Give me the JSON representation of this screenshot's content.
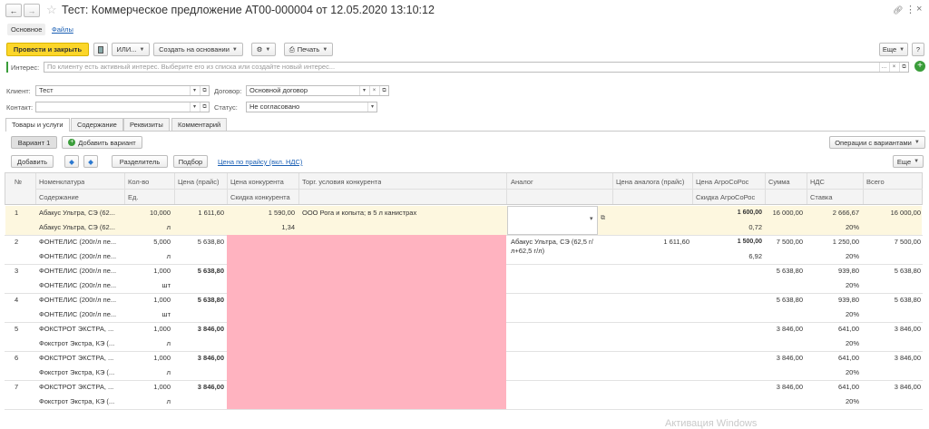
{
  "window": {
    "title": "Тест: Коммерческое предложение АТ00-000004 от 12.05.2020 13:10:12",
    "tabs": [
      "Основное",
      "Файлы"
    ]
  },
  "toolbar": {
    "post_close": "Провести и закрыть",
    "ili": "ИЛИ...",
    "create_based": "Создать на основании",
    "print": "Печать",
    "more": "Еще",
    "help": "?"
  },
  "interest": {
    "label": "Интерес:",
    "placeholder": "По клиенту есть активный интерес. Выберите его из списка или создайте новый интерес..."
  },
  "form": {
    "client_label": "Клиент:",
    "client_value": "Тест",
    "contract_label": "Договор:",
    "contract_value": "Основной договор",
    "contact_label": "Контакт:",
    "contact_value": "",
    "status_label": "Статус:",
    "status_value": "Не согласовано"
  },
  "content_tabs": [
    "Товары и услуги",
    "Содержание",
    "Реквизиты",
    "Комментарий"
  ],
  "variants": {
    "variant1": "Вариант 1",
    "add_variant": "Добавить вариант",
    "ops": "Операции с вариантами"
  },
  "table_toolbar": {
    "add": "Добавить",
    "splitter": "Разделитель",
    "selection": "Подбор",
    "price_link": "Цена по прайсу (вкл. НДС)",
    "more": "Еще"
  },
  "columns": {
    "num": "№",
    "nomenclature": "Номенклатура",
    "content": "Содержание",
    "qty": "Кол-во",
    "unit": "Ед.",
    "price": "Цена (прайс)",
    "comp_price": "Цена конкурента",
    "comp_discount": "Скидка конкурента",
    "comp_terms": "Торг. условия конкурента",
    "analog": "Аналог",
    "analog_price": "Цена аналога (прайс)",
    "agro_price": "Цена АгроСоРос",
    "agro_discount": "Скидка АгроСоРос",
    "sum": "Сумма",
    "vat": "НДС",
    "rate": "Ставка",
    "total": "Всего"
  },
  "rows": [
    {
      "n": "1",
      "nom": "Абакус Ультра, СЭ (62...",
      "cont": "Абакус Ультра, СЭ (62...",
      "qty": "10,000",
      "unit": "л",
      "price": "1 611,60",
      "cprice": "1 590,00",
      "cdisc": "1,34",
      "terms": "ООО Рога и копыта; в 5 л канистрах",
      "analog": "",
      "aprice": "",
      "agro": "1 600,00",
      "adisc": "0,72",
      "sum": "16 000,00",
      "vat": "2 666,67",
      "rate": "20%",
      "total": "16 000,00"
    },
    {
      "n": "2",
      "nom": "ФОНТЕЛИС (200г/л пе...",
      "cont": "ФОНТЕЛИС (200г/л пе...",
      "qty": "5,000",
      "unit": "л",
      "price": "5 638,80",
      "cprice": "",
      "cdisc": "",
      "terms": "",
      "analog": "Абакус Ультра, СЭ (62,5 г/л+62,5 г/л)",
      "aprice": "1 611,60",
      "agro": "1 500,00",
      "adisc": "6,92",
      "sum": "7 500,00",
      "vat": "1 250,00",
      "rate": "20%",
      "total": "7 500,00"
    },
    {
      "n": "3",
      "nom": "ФОНТЕЛИС (200г/л пе...",
      "cont": "ФОНТЕЛИС (200г/л пе...",
      "qty": "1,000",
      "unit": "шт",
      "price": "5 638,80",
      "cprice": "",
      "cdisc": "",
      "terms": "",
      "analog": "",
      "aprice": "",
      "agro": "",
      "adisc": "",
      "sum": "5 638,80",
      "vat": "939,80",
      "rate": "20%",
      "total": "5 638,80"
    },
    {
      "n": "4",
      "nom": "ФОНТЕЛИС (200г/л пе...",
      "cont": "ФОНТЕЛИС (200г/л пе...",
      "qty": "1,000",
      "unit": "шт",
      "price": "5 638,80",
      "cprice": "",
      "cdisc": "",
      "terms": "",
      "analog": "",
      "aprice": "",
      "agro": "",
      "adisc": "",
      "sum": "5 638,80",
      "vat": "939,80",
      "rate": "20%",
      "total": "5 638,80"
    },
    {
      "n": "5",
      "nom": "ФОКСТРОТ ЭКСТРА, ...",
      "cont": "Фокстрот Экстра, КЭ (...",
      "qty": "1,000",
      "unit": "л",
      "price": "3 846,00",
      "cprice": "",
      "cdisc": "",
      "terms": "",
      "analog": "",
      "aprice": "",
      "agro": "",
      "adisc": "",
      "sum": "3 846,00",
      "vat": "641,00",
      "rate": "20%",
      "total": "3 846,00"
    },
    {
      "n": "6",
      "nom": "ФОКСТРОТ ЭКСТРА, ...",
      "cont": "Фокстрот Экстра, КЭ (...",
      "qty": "1,000",
      "unit": "л",
      "price": "3 846,00",
      "cprice": "",
      "cdisc": "",
      "terms": "",
      "analog": "",
      "aprice": "",
      "agro": "",
      "adisc": "",
      "sum": "3 846,00",
      "vat": "641,00",
      "rate": "20%",
      "total": "3 846,00"
    },
    {
      "n": "7",
      "nom": "ФОКСТРОТ ЭКСТРА, ...",
      "cont": "Фокстрот Экстра, КЭ (...",
      "qty": "1,000",
      "unit": "л",
      "price": "3 846,00",
      "cprice": "",
      "cdisc": "",
      "terms": "",
      "analog": "",
      "aprice": "",
      "agro": "",
      "adisc": "",
      "sum": "3 846,00",
      "vat": "641,00",
      "rate": "20%",
      "total": "3 846,00"
    }
  ],
  "watermark": "Активация Windows",
  "colors": {
    "accent": "#fcd629",
    "selected_row": "#fdf7df",
    "highlight": "#ffb3c0",
    "link": "#1a5fb4"
  }
}
